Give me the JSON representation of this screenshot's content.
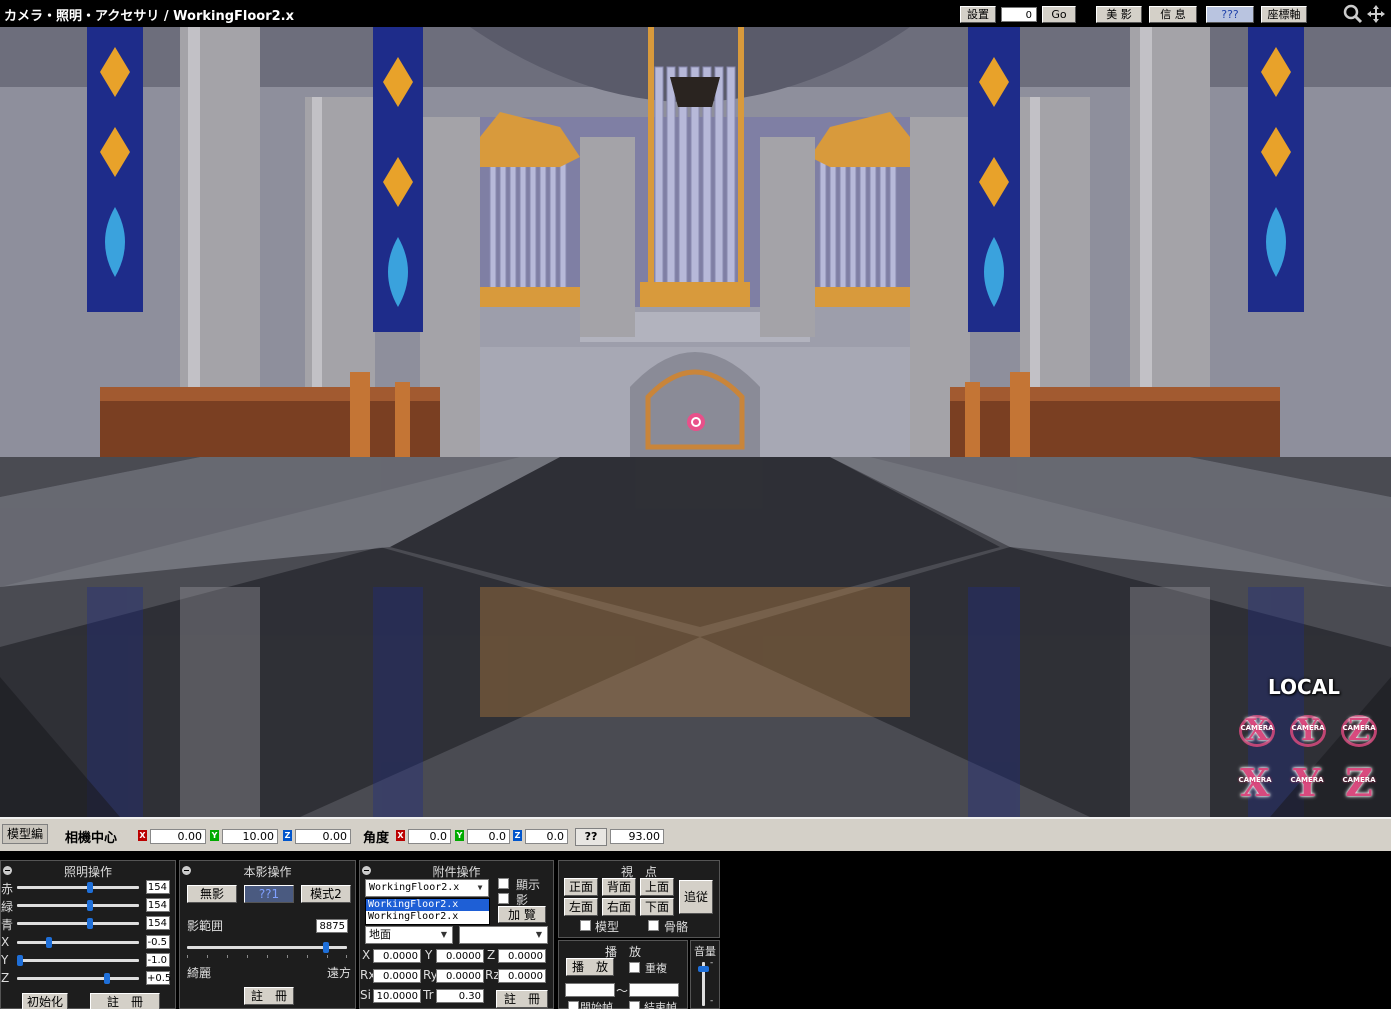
{
  "window": {
    "title": "カメラ・照明・アクセサリ / WorkingFloor2.x"
  },
  "toolbar": {
    "setup_label": "設置",
    "setup_value": "0",
    "go_label": "Go",
    "beauty_label": "美 影",
    "info_label": "信 息",
    "unknown_label": "???",
    "axis_label": "座標軸"
  },
  "viewport": {
    "local_label": "LOCAL",
    "camera_gizmos": [
      {
        "letter": "X",
        "sub": "CAMERA"
      },
      {
        "letter": "Y",
        "sub": "CAMERA"
      },
      {
        "letter": "Z",
        "sub": "CAMERA"
      }
    ],
    "axis_gizmos": [
      {
        "letter": "X",
        "sub": "CAMERA"
      },
      {
        "letter": "Y",
        "sub": "CAMERA"
      },
      {
        "letter": "Z",
        "sub": "CAMERA"
      }
    ]
  },
  "statusbar": {
    "mode_label": "模型編",
    "center_label": "相機中心",
    "x_axis": "X",
    "y_axis": "Y",
    "z_axis": "Z",
    "center_x": "0.00",
    "center_y": "10.00",
    "center_z": "0.00",
    "angle_label": "角度",
    "angle_x": "0.0",
    "angle_y": "0.0",
    "angle_z": "0.0",
    "fov_button": "??",
    "fov_value": "93.00"
  },
  "lighting_panel": {
    "title": "照明操作",
    "rows": [
      {
        "label": "赤",
        "value": "154",
        "level": 0.6
      },
      {
        "label": "緑",
        "value": "154",
        "level": 0.6
      },
      {
        "label": "青",
        "value": "154",
        "level": 0.6
      },
      {
        "label": "X",
        "value": "-0.5",
        "level": 0.25
      },
      {
        "label": "Y",
        "value": "-1.0",
        "level": 0.0
      },
      {
        "label": "Z",
        "value": "+0.5",
        "level": 0.75
      }
    ],
    "reset_button": "初始化",
    "register_button": "註　冊"
  },
  "shadow_panel": {
    "title": "本影操作",
    "none_button": "無影",
    "mode1_button": "??1",
    "mode2_button": "模式2",
    "range_label": "影範囲",
    "range_value": "8875",
    "range_level": 0.88,
    "near_label": "綺麗",
    "far_label": "遠方",
    "register_button": "註　冊"
  },
  "accessory_panel": {
    "title": "附件操作",
    "selected": "WorkingFloor2.x",
    "dropdown_options": [
      "WorkingFloor2.x",
      "WorkingFloor2.x"
    ],
    "show_label": "顯示",
    "shadow_label": "影",
    "add_button": "加 覽",
    "parent_select": "地面",
    "x_label": "X",
    "x_value": "0.0000",
    "y_label": "Y",
    "y_value": "0.0000",
    "z_label": "Z",
    "z_value": "0.0000",
    "rx_label": "Rx",
    "rx_value": "0.0000",
    "ry_label": "Ry",
    "ry_value": "0.0000",
    "rz_label": "Rz",
    "rz_value": "0.0000",
    "si_label": "Si",
    "si_value": "10.0000",
    "tr_label": "Tr",
    "tr_value": "0.30",
    "register_button": "註　冊"
  },
  "view_panel": {
    "title": "視　点",
    "front": "正面",
    "back": "背面",
    "top": "上面",
    "left": "左面",
    "right": "右面",
    "bottom": "下面",
    "follow": "追従",
    "model_label": "模型",
    "bone_label": "骨骼"
  },
  "play_panel": {
    "title": "播　放",
    "play_button": "播　放",
    "repeat_label": "重複",
    "tilde": "～",
    "start_label": "開始幀",
    "end_label": "結束幀"
  },
  "volume_panel": {
    "title": "音量",
    "level": 0.9
  },
  "colors": {
    "accent_pink": "#d84a7e",
    "slider_blue": "#1e6fd9",
    "panel_bg": "#1d1d1d"
  }
}
